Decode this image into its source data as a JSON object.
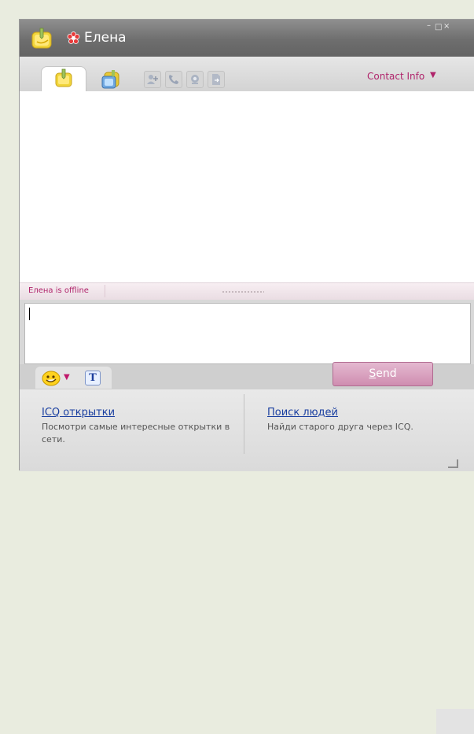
{
  "window": {
    "contact_name": "Елена",
    "controls": {
      "minimize": "–",
      "maximize": "□",
      "close": "×"
    }
  },
  "tabs": {
    "icons": [
      "messages-tab-icon",
      "history-tab-icon"
    ],
    "tools": [
      "add-contact-icon",
      "call-icon",
      "webcam-icon",
      "send-file-icon"
    ],
    "contact_info_label": "Contact Info",
    "contact_info_arrow": "▼"
  },
  "status": {
    "offline_text": "Елена is offline"
  },
  "compose": {
    "message_value": "",
    "smiley_arrow": "▼",
    "font_button_label": "T",
    "send_mnemonic": "S",
    "send_rest": "end"
  },
  "promo": {
    "left": {
      "title": "ICQ открытки",
      "description": "Посмотри самые интересные открытки в сети."
    },
    "right": {
      "title": "Поиск людей",
      "description": "Найди старого друга через ICQ."
    }
  },
  "colors": {
    "accent": "#b0246b",
    "link": "#1a3fa0",
    "send_button": "#cf8db0",
    "titlebar": "#6e6e6e"
  }
}
